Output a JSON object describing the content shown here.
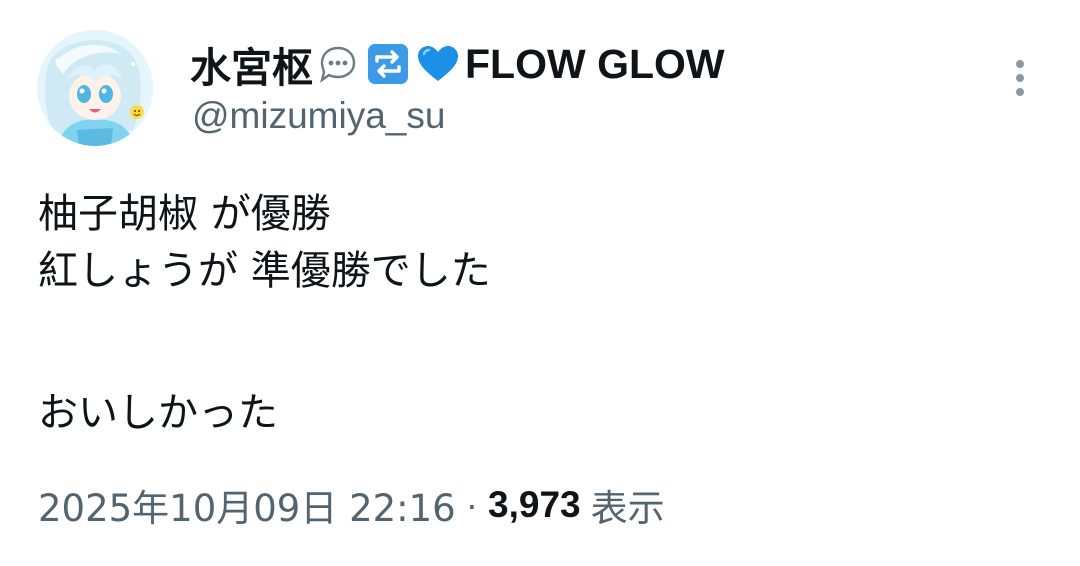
{
  "author": {
    "display_name": "水宮枢",
    "name_suffix": "FLOW GLOW",
    "name_emojis": [
      "speech-balloon-emoji",
      "repeat-arrows-emoji",
      "blue-heart-emoji"
    ],
    "handle": "@mizumiya_su"
  },
  "tweet": {
    "lines": [
      "柚子胡椒 が優勝",
      "紅しょうが 準優勝でした",
      "",
      "おいしかった"
    ]
  },
  "meta": {
    "timestamp": "2025年10月09日 22:16",
    "separator": "·",
    "views_count": "3,973",
    "views_label": "表示"
  },
  "colors": {
    "text_primary": "#0f1419",
    "text_secondary": "#536471",
    "emoji_blue": "#3c9ae8",
    "heart_blue": "#1c8fe6"
  },
  "icons": {
    "more": "more-vertical-icon"
  }
}
